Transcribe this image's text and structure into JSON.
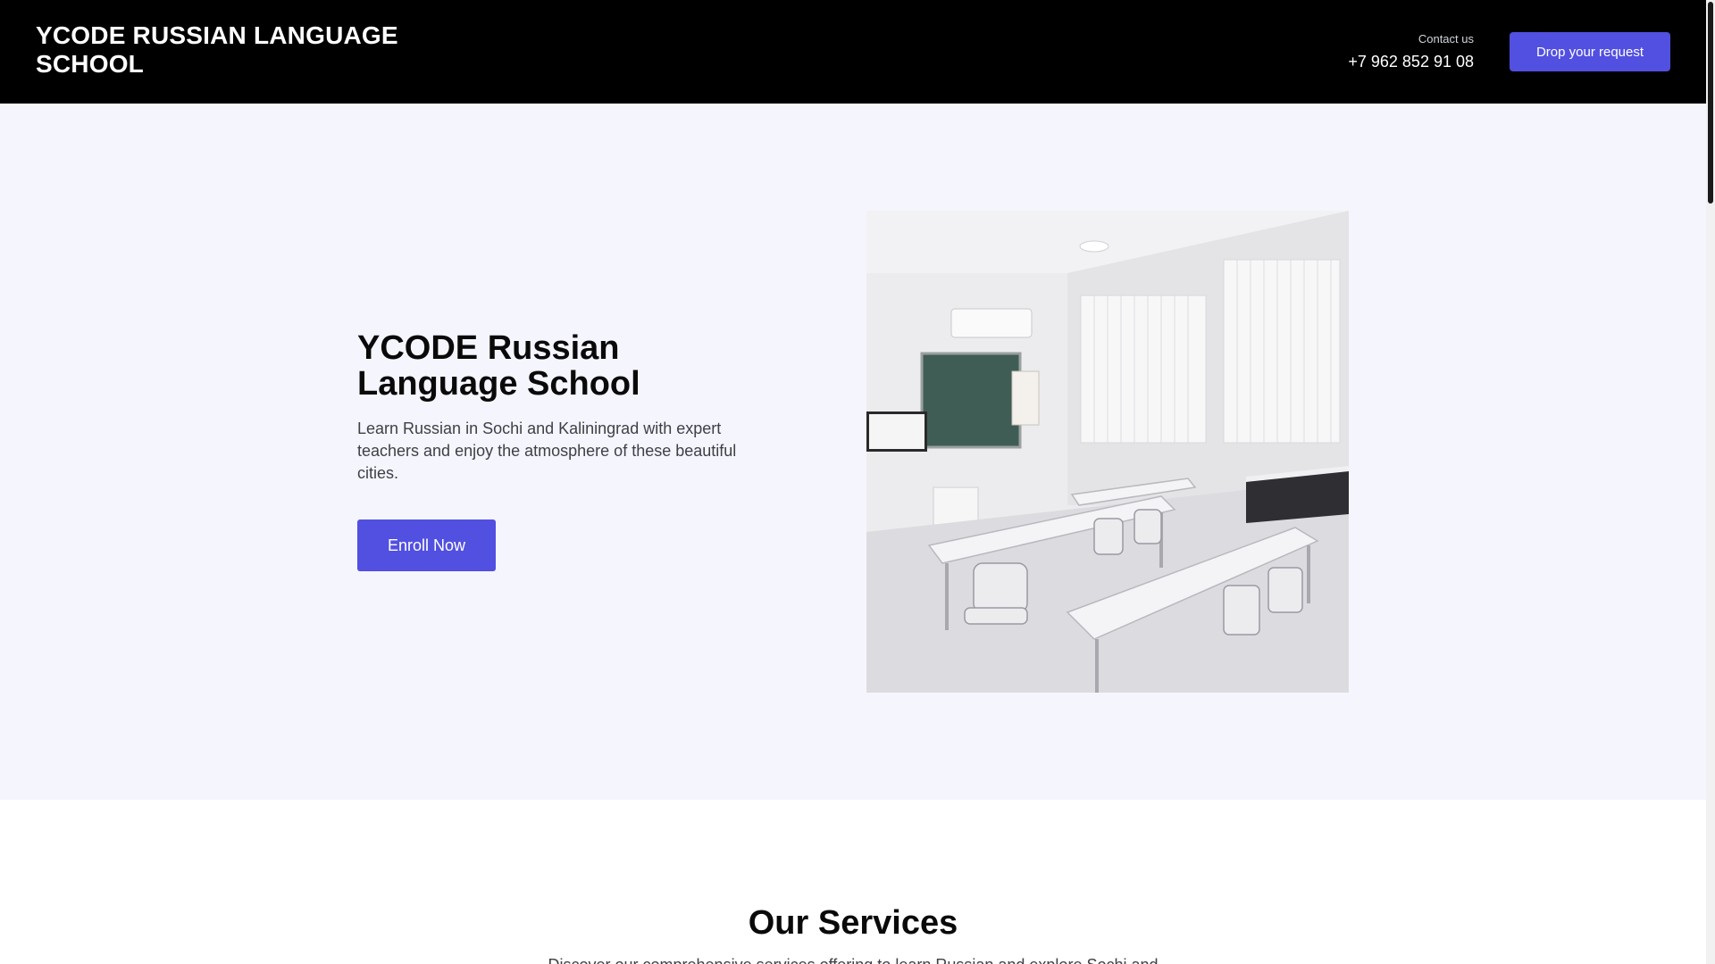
{
  "header": {
    "logo": "YCODE RUSSIAN LANGUAGE SCHOOL",
    "contact_label": "Contact us",
    "phone": "+7 962 852 91 08",
    "request_button": "Drop your request"
  },
  "hero": {
    "title": "YCODE Russian Language School",
    "description": "Learn Russian in Sochi and Kaliningrad with expert teachers and enjoy the atmosphere of these beautiful cities.",
    "cta": "Enroll Now",
    "image_subject": "classroom-photo"
  },
  "services": {
    "title": "Our Services",
    "subtitle": "Discover our comprehensive services offering to learn Russian and explore Sochi and"
  },
  "colors": {
    "accent": "#5250e0",
    "header_bg": "#000000",
    "hero_bg": "#f5f5fe",
    "text_dark": "#0a0a0a",
    "text_body": "#3f3f46"
  }
}
